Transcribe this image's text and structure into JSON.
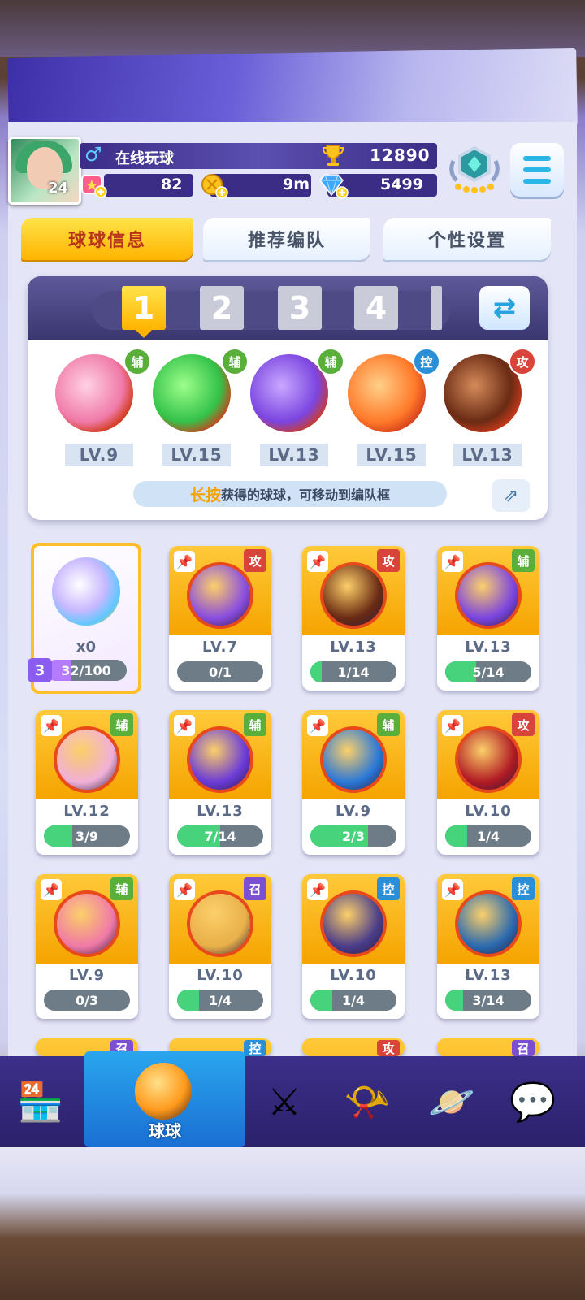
{
  "header": {
    "player_level": "24",
    "gender_icon": "male-icon",
    "player_name": "在线玩球",
    "trophy_value": "12890",
    "resource_a": "82",
    "resource_b": "9m",
    "gems": "5499"
  },
  "tabs": [
    {
      "label": "球球信息",
      "active": true
    },
    {
      "label": "推荐编队",
      "active": false
    },
    {
      "label": "个性设置",
      "active": false
    }
  ],
  "team": {
    "slots": [
      "1",
      "2",
      "3",
      "4"
    ],
    "active_slot": 0,
    "balls": [
      {
        "level": "LV.9",
        "type": "辅",
        "color": "#f07aa8",
        "icon": "heart-wings-ball"
      },
      {
        "level": "LV.15",
        "type": "辅",
        "color": "#34c24a",
        "icon": "arrow-up-ball"
      },
      {
        "level": "LV.13",
        "type": "辅",
        "color": "#7b45e0",
        "icon": "lightning-ball"
      },
      {
        "level": "LV.15",
        "type": "控",
        "color": "#ff7a2a",
        "icon": "gorilla-ball"
      },
      {
        "level": "LV.13",
        "type": "攻",
        "color": "#6a2b14",
        "icon": "infinity-ball"
      }
    ],
    "hint_em": "长按",
    "hint_rest": "获得的球球，可移动到编队框"
  },
  "special": {
    "count": "x0",
    "progress": "32/100",
    "fill": 0.32
  },
  "cards": [
    {
      "level": "LV.7",
      "type": "攻",
      "progress": "0/1",
      "fill": 0.0,
      "color": "#8a4de0"
    },
    {
      "level": "LV.13",
      "type": "攻",
      "progress": "1/14",
      "fill": 0.07,
      "color": "#6a2b14"
    },
    {
      "level": "LV.13",
      "type": "辅",
      "progress": "5/14",
      "fill": 0.36,
      "color": "#7b45e0"
    },
    {
      "level": "LV.12",
      "type": "辅",
      "progress": "3/9",
      "fill": 0.33,
      "color": "#f0b0d8"
    },
    {
      "level": "LV.13",
      "type": "辅",
      "progress": "7/14",
      "fill": 0.5,
      "color": "#6a3bd8"
    },
    {
      "level": "LV.9",
      "type": "辅",
      "progress": "2/3",
      "fill": 0.67,
      "color": "#2a78d8"
    },
    {
      "level": "LV.10",
      "type": "攻",
      "progress": "1/4",
      "fill": 0.25,
      "color": "#b01a24"
    },
    {
      "level": "LV.9",
      "type": "辅",
      "progress": "0/3",
      "fill": 0.0,
      "color": "#f07aa8"
    },
    {
      "level": "LV.10",
      "type": "召",
      "progress": "1/4",
      "fill": 0.25,
      "color": "#e8b04a"
    },
    {
      "level": "LV.10",
      "type": "控",
      "progress": "1/4",
      "fill": 0.25,
      "color": "#4a3d8a"
    },
    {
      "level": "LV.13",
      "type": "控",
      "progress": "3/14",
      "fill": 0.21,
      "color": "#2a6ab0"
    }
  ],
  "partial_row_types": [
    "召",
    "控",
    "攻",
    "召"
  ],
  "nav": [
    {
      "icon": "shop-icon"
    },
    {
      "icon": "ball-icon",
      "label": "球球",
      "active": true
    },
    {
      "icon": "crossed-swords-icon"
    },
    {
      "icon": "whistle-icon"
    },
    {
      "icon": "planet-icon"
    },
    {
      "icon": "chat-heart-icon"
    }
  ],
  "colors": {
    "accent": "#ffb400",
    "nav": "#2b216b",
    "fu": "#5aae3a",
    "gong": "#d9443a",
    "kong": "#2b8fd8",
    "zhao": "#7a4fd2"
  }
}
